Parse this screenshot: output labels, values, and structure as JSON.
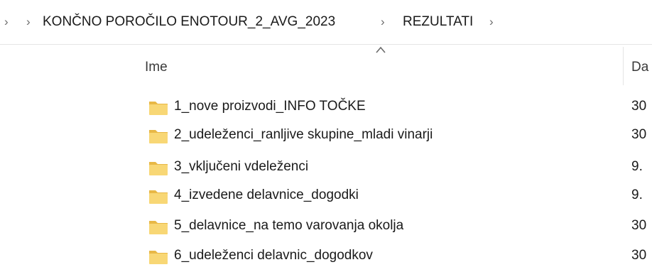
{
  "address_bar": {
    "breadcrumbs": [
      "KONČNO POROČILO ENOTOUR_2_AVG_2023",
      "REZULTATI"
    ],
    "separator_glyph": "›",
    "separator_icon": "chevron-right-icon"
  },
  "columns": {
    "name_label": "Ime",
    "date_label": "Da",
    "sort_icon": "sort-ascending-icon"
  },
  "files": [
    {
      "name": "1_nove proizvodi_INFO TOČKE",
      "date": "30",
      "icon": "folder-icon"
    },
    {
      "name": "2_udeleženci_ranljive skupine_mladi vinarji",
      "date": "30",
      "icon": "folder-icon"
    },
    {
      "name": "3_vključeni vdeleženci",
      "date": "9.",
      "icon": "folder-icon"
    },
    {
      "name": "4_izvedene delavnice_dogodki",
      "date": "9.",
      "icon": "folder-icon"
    },
    {
      "name": "5_delavnice_na temo varovanja okolja",
      "date": "30",
      "icon": "folder-icon"
    },
    {
      "name": "6_udeleženci delavnic_dogodkov",
      "date": "30",
      "icon": "folder-icon"
    }
  ],
  "colors": {
    "folder_body": "#f8d775",
    "folder_tab": "#e8b846",
    "separator": "#6b6b6b"
  }
}
